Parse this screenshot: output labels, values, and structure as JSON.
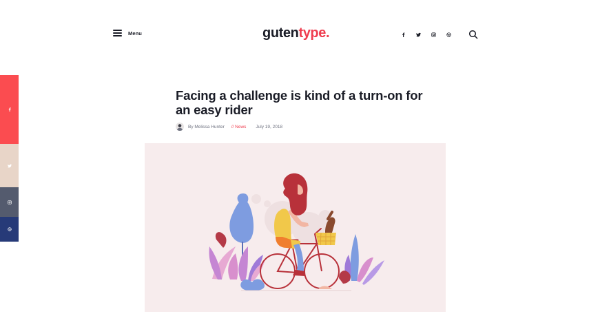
{
  "header": {
    "menu_label": "Menu",
    "logo_main": "guten",
    "logo_accent": "type."
  },
  "social_top": [
    "facebook-icon",
    "twitter-icon",
    "instagram-icon",
    "dribbble-icon"
  ],
  "share_bar": [
    "facebook-icon",
    "twitter-icon",
    "instagram-icon",
    "dribbble-icon"
  ],
  "article": {
    "title": "Facing a challenge is kind of a turn-on for an easy rider",
    "author": "By Melissa Hunter",
    "category": "// News",
    "date": "July 19, 2018"
  },
  "colors": {
    "accent": "#ef3d4f",
    "text": "#1a1c26",
    "share_facebook": "#fb4c50",
    "share_twitter": "#e8d5c8",
    "share_instagram": "#545b6e",
    "share_dribbble": "#263a78",
    "hero_background": "#f7eced"
  }
}
